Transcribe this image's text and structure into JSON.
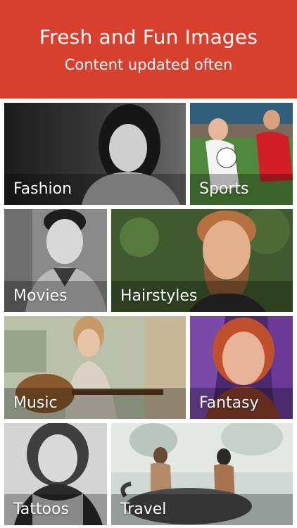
{
  "header": {
    "title": "Fresh and Fun Images",
    "subtitle": "Content updated often",
    "background_color": "#d6402c"
  },
  "categories": [
    {
      "id": "fashion",
      "label": "Fashion"
    },
    {
      "id": "sports",
      "label": "Sports"
    },
    {
      "id": "movies",
      "label": "Movies"
    },
    {
      "id": "hairstyles",
      "label": "Hairstyles"
    },
    {
      "id": "music",
      "label": "Music"
    },
    {
      "id": "fantasy",
      "label": "Fantasy"
    },
    {
      "id": "tattoos",
      "label": "Tattoos"
    },
    {
      "id": "travel",
      "label": "Travel"
    }
  ]
}
